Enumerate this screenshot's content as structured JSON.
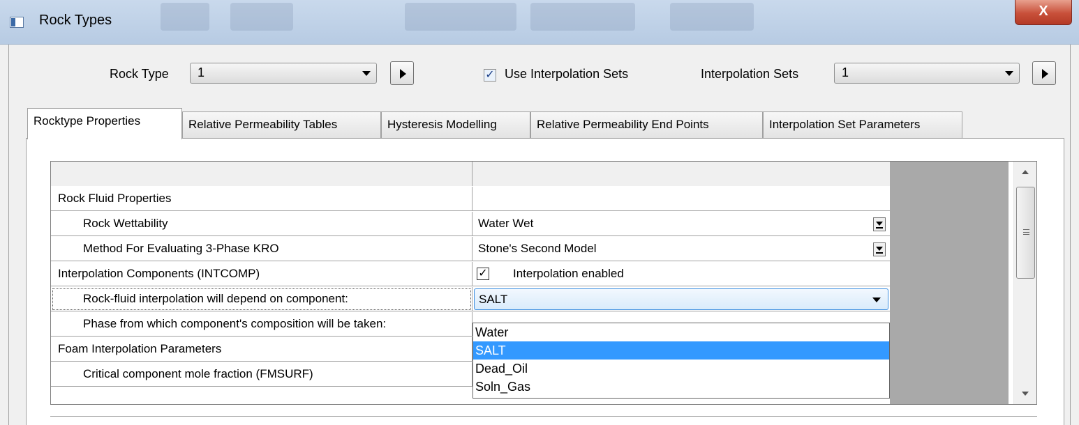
{
  "window": {
    "title": "Rock Types",
    "close_glyph": "X"
  },
  "toolbar": {
    "rock_type_label": "Rock Type",
    "rock_type_value": "1",
    "use_interpolation_label": "Use Interpolation Sets",
    "use_interpolation_checked": true,
    "interpolation_sets_label": "Interpolation Sets",
    "interpolation_sets_value": "1"
  },
  "tabs": [
    {
      "label": "Rocktype Properties",
      "active": true
    },
    {
      "label": "Relative Permeability Tables"
    },
    {
      "label": "Hysteresis Modelling"
    },
    {
      "label": "Relative Permeability End Points"
    },
    {
      "label": "Interpolation Set Parameters"
    }
  ],
  "grid": {
    "rows": [
      {
        "label": "Rock Fluid Properties",
        "value": ""
      },
      {
        "label": "Rock Wettability",
        "value": "Water Wet"
      },
      {
        "label": "Method For Evaluating 3-Phase KRO",
        "value": "Stone's Second Model"
      },
      {
        "label": "Interpolation Components (INTCOMP)",
        "value": "Interpolation enabled",
        "checked": true
      },
      {
        "label": "Rock-fluid interpolation will depend on component:",
        "value": "SALT"
      },
      {
        "label": "Phase from which component's composition will be taken:",
        "value": ""
      },
      {
        "label": "Foam Interpolation Parameters",
        "value": ""
      },
      {
        "label": "Critical component mole fraction (FMSURF)",
        "value": ""
      }
    ]
  },
  "dropdown": {
    "options": [
      "Water",
      "SALT",
      "Dead_Oil",
      "Soln_Gas"
    ],
    "selected": "SALT"
  },
  "colors": {
    "selection": "#3399ff",
    "titlebar": "#c9d9ec",
    "close_button": "#c8503a"
  }
}
